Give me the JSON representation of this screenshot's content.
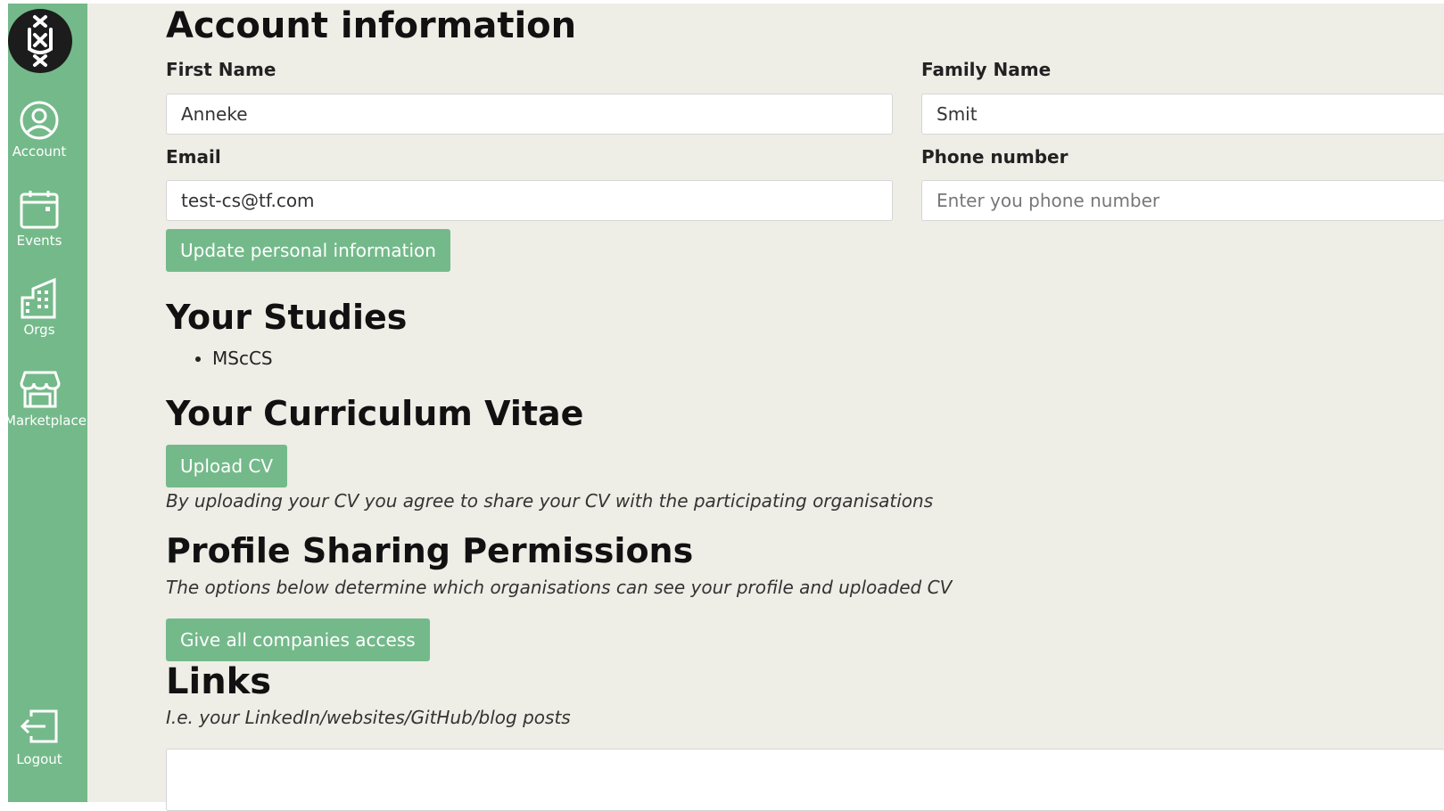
{
  "sidebar": {
    "logo_icon": "university-crest-icon",
    "items": [
      {
        "label": "Account",
        "icon": "account-icon"
      },
      {
        "label": "Events",
        "icon": "calendar-icon"
      },
      {
        "label": "Orgs",
        "icon": "building-icon"
      },
      {
        "label": "Marketplace",
        "icon": "store-icon"
      }
    ],
    "logout": {
      "label": "Logout",
      "icon": "logout-icon"
    },
    "color": "#74b98a"
  },
  "account": {
    "title": "Account information",
    "first_name_label": "First Name",
    "first_name_value": "Anneke",
    "family_name_label": "Family Name",
    "family_name_value": "Smit",
    "email_label": "Email",
    "email_value": "test-cs@tf.com",
    "phone_label": "Phone number",
    "phone_placeholder": "Enter you phone number",
    "update_button": "Update personal information"
  },
  "studies": {
    "title": "Your Studies",
    "items": [
      "MScCS"
    ]
  },
  "cv": {
    "title": "Your Curriculum Vitae",
    "upload_button": "Upload CV",
    "note": "By uploading your CV you agree to share your CV with the participating organisations"
  },
  "permissions": {
    "title": "Profile Sharing Permissions",
    "description": "The options below determine which organisations can see your profile and uploaded CV",
    "give_all_button": "Give all companies access"
  },
  "links": {
    "title": "Links",
    "description": "I.e. your LinkedIn/websites/GitHub/blog posts",
    "value": ""
  }
}
